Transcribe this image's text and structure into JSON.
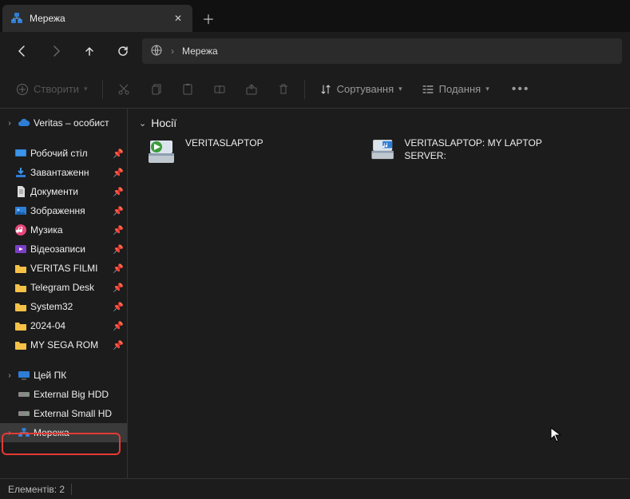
{
  "tab": {
    "title": "Мережа"
  },
  "breadcrumb": {
    "location": "Мережа"
  },
  "toolbar": {
    "create": "Створити",
    "sort": "Сортування",
    "view": "Подання"
  },
  "sidebar": {
    "onedrive": "Veritas – особист",
    "quick": [
      "Робочий стіл",
      "Завантаженн",
      "Документи",
      "Зображення",
      "Музика",
      "Відеозаписи",
      "VERITAS FILMI",
      "Telegram Desk",
      "System32",
      "2024-04",
      "MY SEGA ROM"
    ],
    "thispc": "Цей ПК",
    "drives": [
      "External Big HDD",
      "External Small HD"
    ],
    "network": "Мережа"
  },
  "content": {
    "group": "Носії",
    "items": [
      {
        "name": "VERITASLAPTOP"
      },
      {
        "name": "VERITASLAPTOP: MY LAPTOP SERVER:"
      }
    ]
  },
  "status": {
    "count_label": "Елементів: 2"
  }
}
